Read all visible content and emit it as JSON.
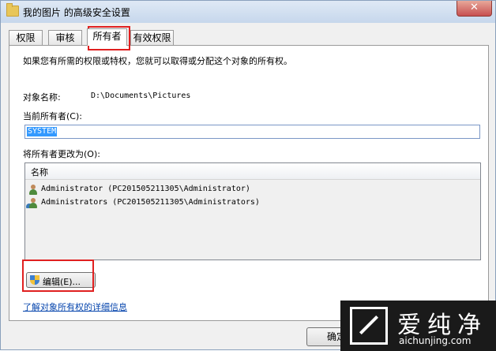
{
  "window": {
    "title": "我的图片 的高级安全设置",
    "close_label": "✕"
  },
  "tabs": [
    {
      "label": "权限"
    },
    {
      "label": "审核"
    },
    {
      "label": "所有者"
    },
    {
      "label": "有效权限"
    }
  ],
  "owner_tab": {
    "description": "如果您有所需的权限或特权，您就可以取得或分配这个对象的所有权。",
    "object_name_label": "对象名称:",
    "object_name_value": "D:\\Documents\\Pictures",
    "current_owner_label": "当前所有者(C):",
    "current_owner_value": "SYSTEM",
    "change_owner_label": "将所有者更改为(O):",
    "list_header": "名称",
    "owners": [
      {
        "name": "Administrator (PC201505211305\\Administrator)"
      },
      {
        "name": "Administrators (PC201505211305\\Administrators)"
      }
    ],
    "edit_button": "编辑(E)...",
    "learn_more_link": "了解对象所有权的详细信息"
  },
  "footer": {
    "ok_button": "确定"
  },
  "watermark": {
    "brand": "爱纯净",
    "url": "aichunjing.com"
  },
  "colors": {
    "highlight": "#e02020",
    "selection": "#3399ff",
    "link": "#0645ad"
  }
}
